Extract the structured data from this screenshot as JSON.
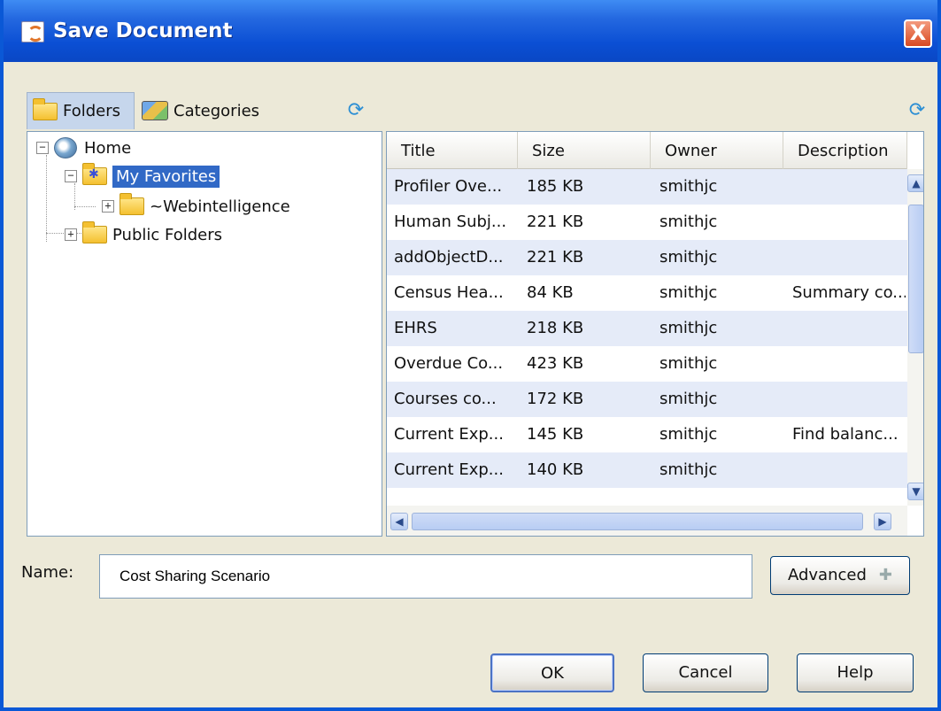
{
  "window": {
    "title": "Save Document",
    "close_glyph": "X"
  },
  "tabs": [
    {
      "label": "Folders",
      "icon": "folder-icon",
      "active": true
    },
    {
      "label": "Categories",
      "icon": "categories-icon",
      "active": false
    }
  ],
  "tree": {
    "home": "Home",
    "my_favorites": "My Favorites",
    "webintelligence": "~Webintelligence",
    "public_folders": "Public Folders"
  },
  "table": {
    "columns": [
      "Title",
      "Size",
      "Owner",
      "Description"
    ],
    "rows": [
      {
        "title": "Profiler Ove...",
        "size": "185 KB",
        "owner": "smithjc",
        "description": ""
      },
      {
        "title": "Human Subj...",
        "size": "221 KB",
        "owner": "smithjc",
        "description": ""
      },
      {
        "title": "addObjectD...",
        "size": "221 KB",
        "owner": "smithjc",
        "description": ""
      },
      {
        "title": "Census Hea...",
        "size": "84 KB",
        "owner": "smithjc",
        "description": "Summary co..."
      },
      {
        "title": "EHRS",
        "size": "218 KB",
        "owner": "smithjc",
        "description": ""
      },
      {
        "title": "Overdue Co...",
        "size": "423 KB",
        "owner": "smithjc",
        "description": ""
      },
      {
        "title": "Courses co...",
        "size": "172 KB",
        "owner": "smithjc",
        "description": ""
      },
      {
        "title": "Current Exp...",
        "size": "145 KB",
        "owner": "smithjc",
        "description": "Find balanc..."
      },
      {
        "title": "Current Exp...",
        "size": "140 KB",
        "owner": "smithjc",
        "description": ""
      }
    ]
  },
  "name_field": {
    "label": "Name:",
    "value": "Cost Sharing Scenario"
  },
  "buttons": {
    "advanced": "Advanced",
    "ok": "OK",
    "cancel": "Cancel",
    "help": "Help"
  },
  "colors": {
    "titlebar": "#0b4fd4",
    "selection": "#3169c6",
    "row_alt": "#e5ebf8"
  }
}
